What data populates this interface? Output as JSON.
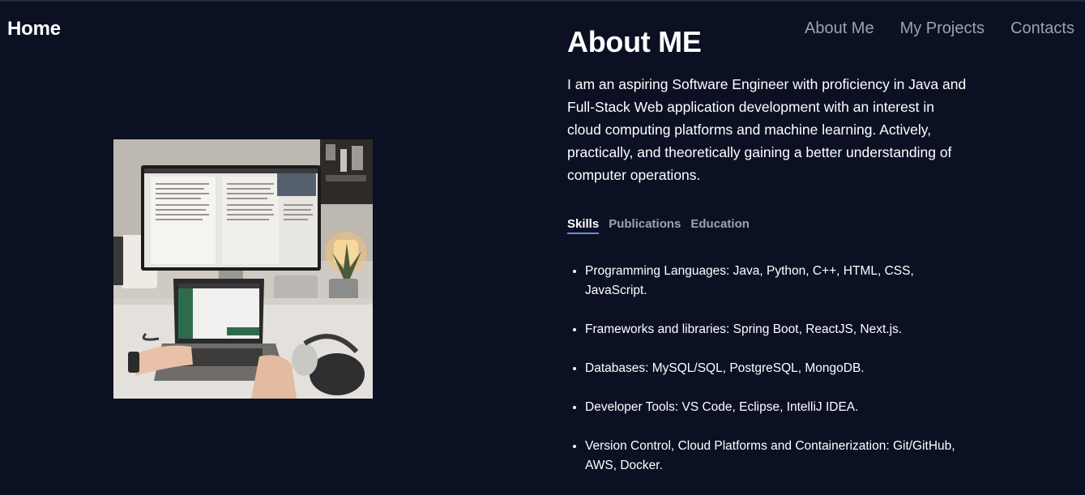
{
  "header": {
    "brand": "Home",
    "nav": [
      "About Me",
      "My Projects",
      "Contacts"
    ]
  },
  "about": {
    "title": "About ME",
    "bio": "I am an aspiring Software Engineer with proficiency in Java and Full-Stack Web application development with an interest in cloud computing platforms and machine learning. Actively, practically, and theoretically gaining a better understanding of computer operations.",
    "tabs": [
      "Skills",
      "Publications",
      "Education"
    ],
    "active_tab": "Skills",
    "skills": [
      "Programming Languages: Java, Python, C++, HTML, CSS, JavaScript.",
      "Frameworks and libraries: Spring Boot, ReactJS, Next.js.",
      "Databases: MySQL/SQL, PostgreSQL, MongoDB.",
      "Developer Tools: VS Code, Eclipse, IntelliJ IDEA.",
      "Version Control, Cloud Platforms and Containerization: Git/GitHub, AWS, Docker."
    ]
  },
  "colors": {
    "background": "#0b1023",
    "nav_text": "#9ca3af",
    "tab_underline": "#6d8ad9"
  }
}
